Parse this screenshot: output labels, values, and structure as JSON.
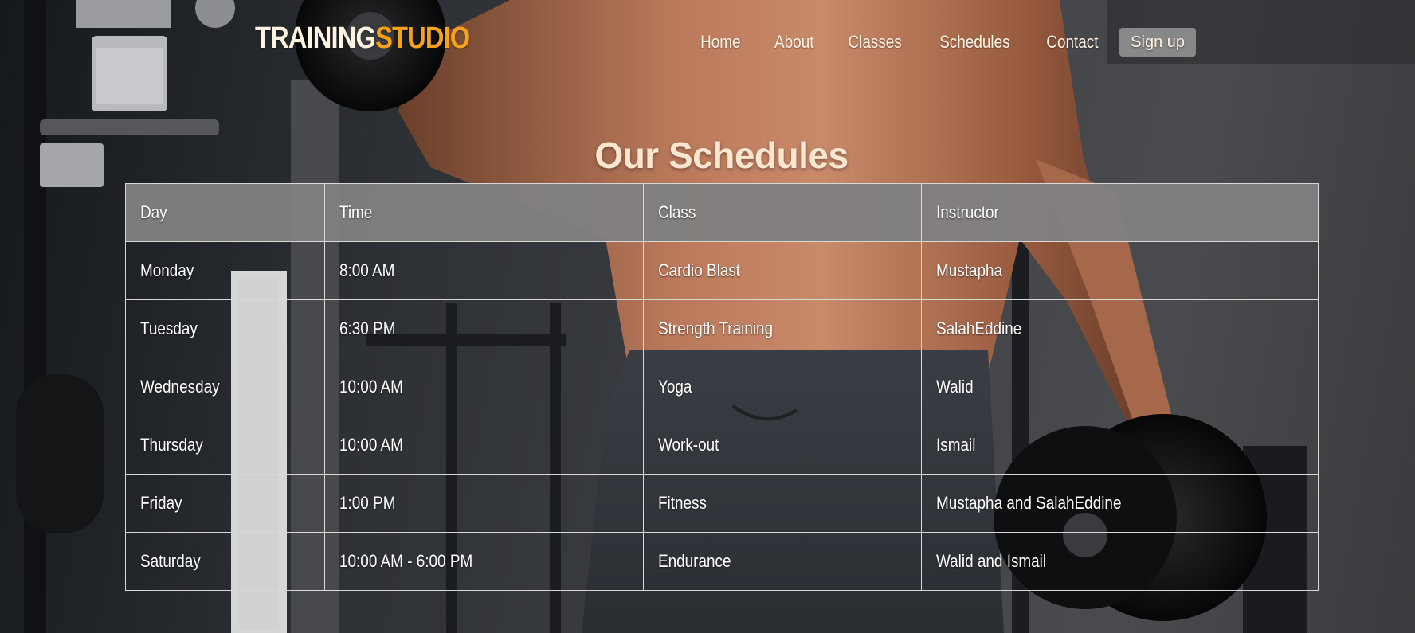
{
  "logo": {
    "part1": "TRAINING",
    "part2": "STUDIO",
    "accent_color": "#f7a21b"
  },
  "nav": {
    "items": [
      {
        "label": "Home"
      },
      {
        "label": "About"
      },
      {
        "label": "Classes"
      },
      {
        "label": "Schedules"
      },
      {
        "label": "Contact"
      }
    ],
    "signup_label": "Sign up"
  },
  "page_title": "Our Schedules",
  "table": {
    "headers": [
      "Day",
      "Time",
      "Class",
      "Instructor"
    ],
    "rows": [
      [
        "Monday",
        "8:00 AM",
        "Cardio Blast",
        "Mustapha"
      ],
      [
        "Tuesday",
        "6:30 PM",
        "Strength Training",
        "SalahEddine"
      ],
      [
        "Wednesday",
        "10:00 AM",
        "Yoga",
        "Walid"
      ],
      [
        "Thursday",
        "10:00 AM",
        "Work-out",
        "Ismail"
      ],
      [
        "Friday",
        "1:00 PM",
        "Fitness",
        "Mustapha and SalahEddine"
      ],
      [
        "Saturday",
        "10:00 AM - 6:00 PM",
        "Endurance",
        "Walid and Ismail"
      ]
    ]
  }
}
